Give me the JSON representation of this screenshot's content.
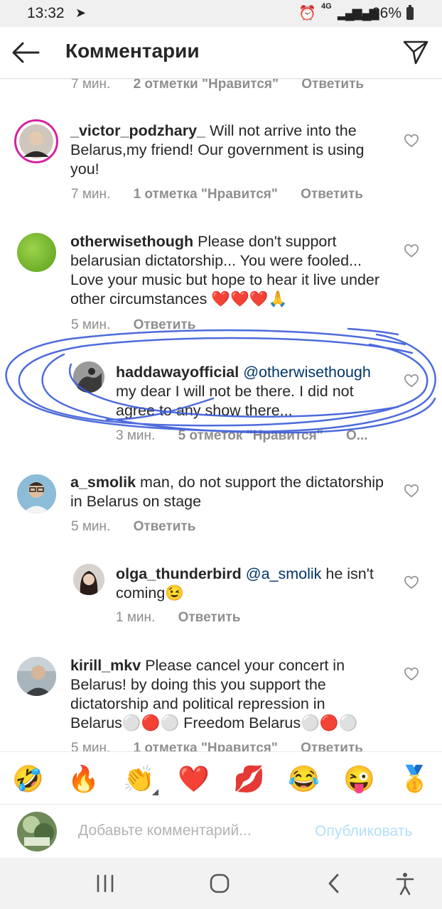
{
  "status": {
    "time": "13:32",
    "network": "4G",
    "battery": "66%"
  },
  "header": {
    "title": "Комментарии"
  },
  "comments": [
    {
      "time": "7 мин.",
      "likes": "2 отметки \"Нравится\"",
      "reply": "Ответить"
    },
    {
      "username": "_victor_podzhary_",
      "text": " Will not arrive into the Belarus,my friend! Our government is using you!",
      "time": "7 мин.",
      "likes": "1 отметка \"Нравится\"",
      "reply": "Ответить"
    },
    {
      "username": "otherwisethough",
      "text": " Please don't support belarusian dictatorship... You were fooled... Love your music but hope to hear it live under other circumstances ❤️❤️❤️🙏",
      "time": "5 мин.",
      "reply": "Ответить"
    },
    {
      "username": "haddawayofficial",
      "mention": " @otherwisethough",
      "text": " my dear I will not be there. I did not agree to any show there...",
      "time": "3 мин.",
      "likes": "5 отметок \"Нравится\"",
      "reply": "О..."
    },
    {
      "username": "a_smolik",
      "text": " man, do not support the dictatorship in Belarus on stage",
      "time": "5 мин.",
      "reply": "Ответить"
    },
    {
      "username": "olga_thunderbird",
      "mention": " @a_smolik",
      "text": " he isn't coming😉",
      "time": "1 мин.",
      "reply": "Ответить"
    },
    {
      "username": "kirill_mkv",
      "text": " Please cancel your concert in Belarus! by doing this you support the dictatorship and political repression in Belarus⚪🔴⚪ Freedom Belarus⚪🔴⚪",
      "time": "5 мин.",
      "likes": "1 отметка \"Нравится\"",
      "reply": "Ответить"
    }
  ],
  "emojis": [
    "🤣",
    "🔥",
    "👏",
    "❤️",
    "💋",
    "😂",
    "😜",
    "🥇"
  ],
  "composer": {
    "placeholder": "Добавьте комментарий...",
    "post_label": "Опубликовать"
  },
  "colors": {
    "mention": "#003569",
    "meta": "#8e8e8e",
    "post_disabled": "#b2dffc",
    "annotation": "#3a5bd9"
  }
}
